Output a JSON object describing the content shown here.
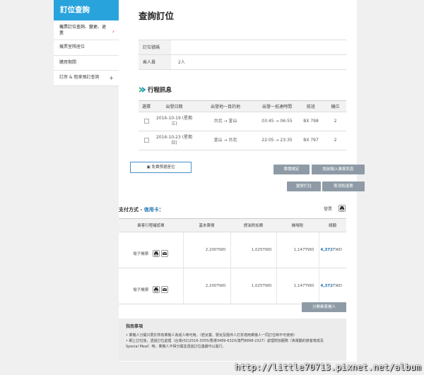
{
  "sidebar": {
    "title": "訂位查詢",
    "items": [
      {
        "label": "機票訂位查詢、變更、退票",
        "active": true
      },
      {
        "label": "機票室隊座位"
      },
      {
        "label": "購買期間"
      },
      {
        "label": "訂房 & 租車預訂查詢"
      }
    ]
  },
  "page": {
    "title": "查詢訂位"
  },
  "booking": {
    "code_label": "訂位號碼",
    "code_value": "",
    "pax_label": "乘人員",
    "pax_value": "2人"
  },
  "itinerary": {
    "title": "行程訊息",
    "headers": [
      "選擇",
      "出發日期",
      "出發地一目的地",
      "出發一抵達時間",
      "航班",
      "機位"
    ],
    "rows": [
      {
        "date": "2016-10-19 (星期三)",
        "route": "台北 → 釜山",
        "time": "03:45 → 06:55",
        "flight": "BX 798",
        "seats": "2"
      },
      {
        "date": "2016-10-23 (星期日)",
        "route": "釜山 → 台北",
        "time": "22:05 → 23:35",
        "flight": "BX 797",
        "seats": "2"
      }
    ]
  },
  "buttons": {
    "free_seat": "免費預選座位",
    "confirm": "票價規定",
    "enter_info": "提前輸入乘客訊息",
    "change": "變更訂位",
    "cancel": "取消和退票",
    "split": "分開乘客機人"
  },
  "payment": {
    "label": "支付方式 - ",
    "method": "信用卡",
    "colon": "：",
    "receipt": "發票",
    "headers": [
      "乘客行程確認單",
      "基本票價",
      "燃油附加費",
      "機場稅",
      "總額"
    ],
    "rows": [
      {
        "doc": "電子機票",
        "base": "2,200TWD",
        "fuel": "1,025TWD",
        "tax": "1,147TWD",
        "total": "4,372",
        "currency": "TWD"
      },
      {
        "doc": "電子機票",
        "base": "2,200TWD",
        "fuel": "1,025TWD",
        "tax": "1,147TWD",
        "total": "4,372",
        "currency": "TWD"
      }
    ]
  },
  "notes": {
    "title": "指南事項",
    "lines": [
      "• 乘機人分開只限於所有乘機人為成人時可用。（若兒童、嬰兒及隨伴人打折適用乘機人一同訂位時不可使用）",
      "• 網上訂位後，透過訂位處理（台灣(02)2516-3355/香港3489-6320/澳門8898-2327）處理附加服務（為電動的旅客寫成及",
      "  Special Meal）時，乘機人不得分開並透過訂位連續可以進行。"
    ]
  },
  "watermark": "http://little70713.pixnet.net/album"
}
